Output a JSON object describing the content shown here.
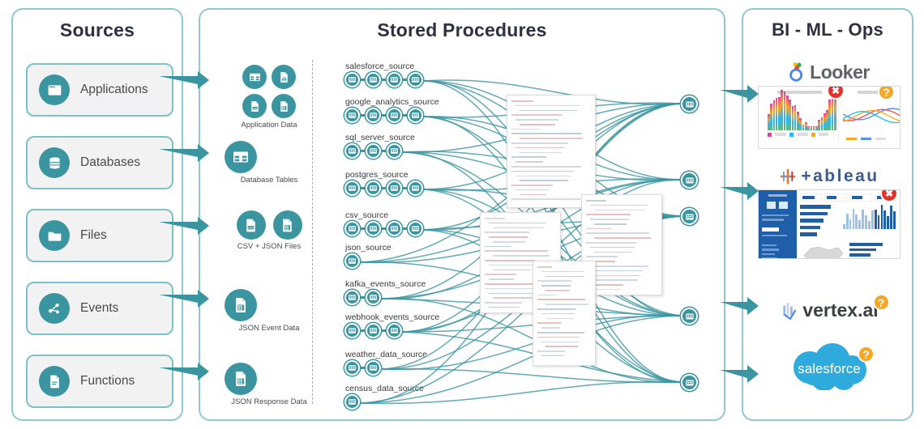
{
  "panels": {
    "sources": {
      "title": "Sources"
    },
    "stored_procedures": {
      "title": "Stored Procedures"
    },
    "bi": {
      "title": "BI - ML - Ops"
    }
  },
  "sources": [
    {
      "label": "Applications",
      "icon": "application-window-icon"
    },
    {
      "label": "Databases",
      "icon": "database-cylinder-icon"
    },
    {
      "label": "Files",
      "icon": "folder-icon"
    },
    {
      "label": "Events",
      "icon": "network-nodes-icon"
    },
    {
      "label": "Functions",
      "icon": "document-function-icon"
    }
  ],
  "middle_groups": [
    {
      "caption": "Application Data",
      "icons": [
        "table-icon",
        "document-chart-icon",
        "document-csv-icon",
        "document-table-icon"
      ],
      "layout": "grid2x2"
    },
    {
      "caption": "Database Tables",
      "icons": [
        "table-icon"
      ],
      "layout": "single"
    },
    {
      "caption": "CSV + JSON Files",
      "icons": [
        "document-csv-icon",
        "document-table-icon"
      ],
      "layout": "pair"
    },
    {
      "caption": "JSON Event Data",
      "icons": [
        "document-table-icon"
      ],
      "layout": "single"
    },
    {
      "caption": "JSON Response Data",
      "icons": [
        "document-table-icon"
      ],
      "layout": "single"
    }
  ],
  "source_chains": [
    {
      "name": "salesforce_source",
      "nodes": 4
    },
    {
      "name": "google_analytics_source",
      "nodes": 4
    },
    {
      "name": "sql_server_source",
      "nodes": 3
    },
    {
      "name": "postgres_source",
      "nodes": 4
    },
    {
      "name": "csv_source",
      "nodes": 4
    },
    {
      "name": "json_source",
      "nodes": 1
    },
    {
      "name": "kafka_events_source",
      "nodes": 2
    },
    {
      "name": "webhook_events_source",
      "nodes": 3
    },
    {
      "name": "weather_data_source",
      "nodes": 2
    },
    {
      "name": "census_data_source",
      "nodes": 1
    }
  ],
  "output_nodes": [
    {
      "icon": "table-icon"
    },
    {
      "icon": "table-icon"
    },
    {
      "icon": "table-icon"
    },
    {
      "icon": "table-icon"
    },
    {
      "icon": "table-icon"
    }
  ],
  "code_cards": [
    {
      "name": "sql-code-card-1"
    },
    {
      "name": "sql-code-card-2"
    },
    {
      "name": "sql-code-card-3"
    },
    {
      "name": "sql-code-card-4"
    }
  ],
  "bi_targets": [
    {
      "logo": "Looker",
      "logo_kind": "looker-logo",
      "thumbnail": "looker-dashboard-thumbnail",
      "badges": [
        "error",
        "warning"
      ]
    },
    {
      "logo": "+ableau",
      "logo_kind": "tableau-logo",
      "thumbnail": "tableau-dashboard-thumbnail",
      "badges": [
        "error"
      ]
    },
    {
      "logo": "vertex.ai",
      "logo_kind": "vertexai-logo",
      "thumbnail": "",
      "badges": [
        "warning"
      ]
    },
    {
      "logo": "salesforce",
      "logo_kind": "salesforce-logo",
      "thumbnail": "",
      "badges": [
        "warning"
      ]
    }
  ],
  "badge_glyphs": {
    "error": "✖",
    "warning": "?"
  },
  "colors": {
    "teal": "#3a95a0",
    "teal_border": "#8fc9cf",
    "card_bg": "#f2f2f2",
    "title": "#2d3142",
    "error_red": "#e8302a",
    "warning_orange": "#f5a623",
    "tableau_blue": "#1f5fa9",
    "salesforce_blue": "#2eaadc"
  }
}
